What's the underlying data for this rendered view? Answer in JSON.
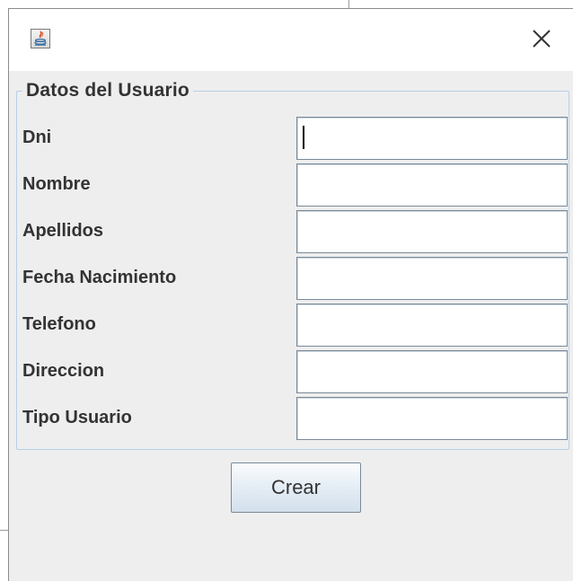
{
  "window": {
    "icon": "java-icon",
    "close_icon": "close-icon"
  },
  "panel": {
    "legend": "Datos del Usuario"
  },
  "fields": [
    {
      "label": "Dni",
      "value": ""
    },
    {
      "label": "Nombre",
      "value": ""
    },
    {
      "label": "Apellidos",
      "value": ""
    },
    {
      "label": "Fecha Nacimiento",
      "value": ""
    },
    {
      "label": "Telefono",
      "value": ""
    },
    {
      "label": "Direccion",
      "value": ""
    },
    {
      "label": "Tipo Usuario",
      "value": ""
    }
  ],
  "actions": {
    "create_label": "Crear"
  },
  "colors": {
    "panel_background": "#eeeeee",
    "titlebar_background": "#ffffff",
    "fieldset_border": "#b8cfe5",
    "label_text": "#333333"
  }
}
